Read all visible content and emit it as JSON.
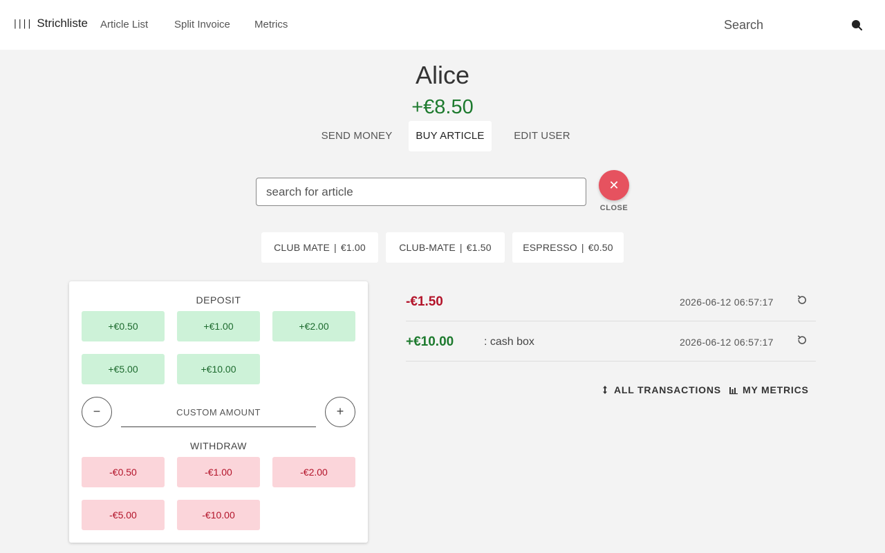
{
  "header": {
    "brand": "Strichliste",
    "brand_icon": "tally-icon",
    "nav": [
      "Article List",
      "Split Invoice",
      "Metrics"
    ],
    "search_placeholder": "Search"
  },
  "user": {
    "name": "Alice",
    "balance": "+€8.50"
  },
  "tabs": [
    {
      "label": "SEND MONEY",
      "active": false
    },
    {
      "label": "BUY ARTICLE",
      "active": true
    },
    {
      "label": "EDIT USER",
      "active": false
    }
  ],
  "article_search": {
    "placeholder": "search for article",
    "close_label": "CLOSE"
  },
  "articles": [
    {
      "name": "CLUB MATE",
      "price": "€1.00"
    },
    {
      "name": "CLUB-MATE",
      "price": "€1.50"
    },
    {
      "name": "ESPRESSO",
      "price": "€0.50"
    }
  ],
  "deposit": {
    "title": "DEPOSIT",
    "amounts": [
      "+€0.50",
      "+€1.00",
      "+€2.00",
      "+€5.00",
      "+€10.00"
    ]
  },
  "custom": {
    "placeholder": "CUSTOM AMOUNT",
    "minus": "−",
    "plus": "+"
  },
  "withdraw": {
    "title": "WITHDRAW",
    "amounts": [
      "-€0.50",
      "-€1.00",
      "-€2.00",
      "-€5.00",
      "-€10.00"
    ]
  },
  "transactions": [
    {
      "amount": "-€1.50",
      "description": "",
      "time": "2026-06-12 06:57:17"
    },
    {
      "amount": "+€10.00",
      "description": ": cash box",
      "time": "2026-06-12 06:57:17"
    }
  ],
  "links": {
    "all_transactions": "ALL TRANSACTIONS",
    "my_metrics": "MY METRICS"
  },
  "colors": {
    "positive": "#1d7a2e",
    "negative": "#b3142a",
    "close_button": "#e6525f",
    "deposit_bg": "#cdf2d8",
    "withdraw_bg": "#fbd5da"
  }
}
